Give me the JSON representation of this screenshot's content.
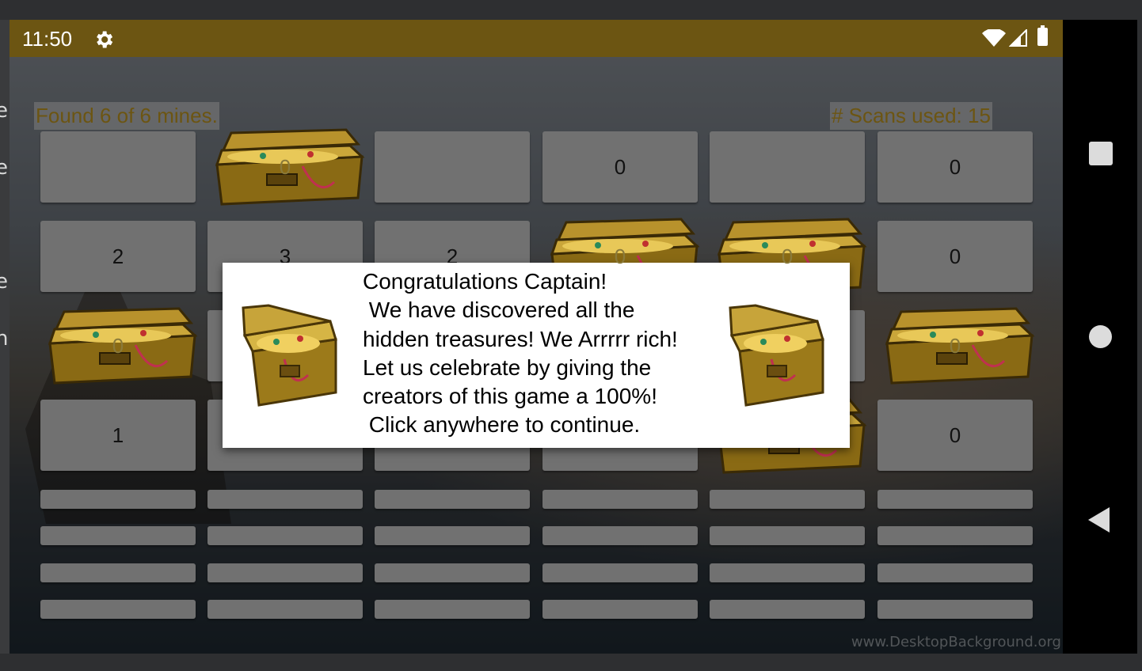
{
  "status_bar": {
    "time": "11:50",
    "icons": [
      "settings-gear-icon",
      "wifi-icon",
      "signal-icon",
      "battery-icon"
    ]
  },
  "left_edge_glyphs": [
    "e",
    "e",
    "e",
    "n"
  ],
  "header": {
    "found_text": "Found 6 of 6 mines.",
    "scans_text": "# Scans used: 15"
  },
  "grid": {
    "rows": [
      [
        {
          "label": "",
          "chest": false
        },
        {
          "label": "0",
          "chest": true
        },
        {
          "label": "",
          "chest": false
        },
        {
          "label": "0",
          "chest": false
        },
        {
          "label": "",
          "chest": false
        },
        {
          "label": "0",
          "chest": false
        }
      ],
      [
        {
          "label": "2",
          "chest": false
        },
        {
          "label": "3",
          "chest": false
        },
        {
          "label": "2",
          "chest": false
        },
        {
          "label": "0",
          "chest": true
        },
        {
          "label": "0",
          "chest": true
        },
        {
          "label": "0",
          "chest": false
        }
      ],
      [
        {
          "label": "0",
          "chest": true
        },
        {
          "label": "",
          "chest": false
        },
        {
          "label": "",
          "chest": false
        },
        {
          "label": "",
          "chest": false
        },
        {
          "label": "",
          "chest": false
        },
        {
          "label": "0",
          "chest": true
        }
      ],
      [
        {
          "label": "1",
          "chest": false
        },
        {
          "label": "",
          "chest": false
        },
        {
          "label": "",
          "chest": false
        },
        {
          "label": "",
          "chest": false
        },
        {
          "label": "",
          "chest": true
        },
        {
          "label": "0",
          "chest": false
        }
      ]
    ],
    "thin_rows": 4
  },
  "dialog": {
    "message": "Congratulations Captain!\n We have discovered all the\nhidden treasures! We Arrrrr rich!\nLet us celebrate by giving the\ncreators of this game a 100%!\n Click anywhere to continue."
  },
  "watermark": "www.DesktopBackground.org",
  "colors": {
    "status_bar": "#6c5512",
    "label_text": "#6c5512",
    "cell": "#717171",
    "dialog_bg": "#ffffff"
  }
}
